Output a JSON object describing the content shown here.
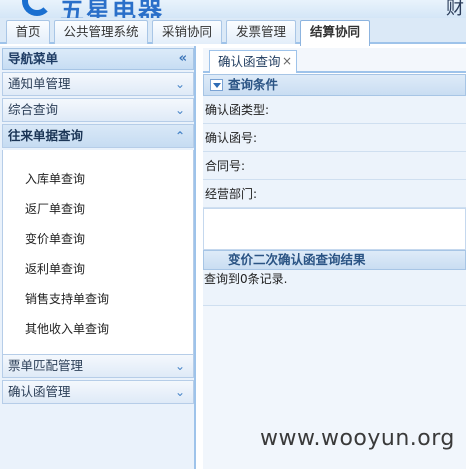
{
  "brand": {
    "logo_text": "五星电器",
    "right_text": "财"
  },
  "topnav": {
    "tabs": [
      "首页",
      "公共管理系统",
      "采销协同",
      "发票管理",
      "结算协同"
    ],
    "active_index": 4
  },
  "sidebar": {
    "title": "导航菜单",
    "collapse_glyph": "«",
    "sections": [
      {
        "label": "通知单管理",
        "glyph": "⌄"
      },
      {
        "label": "综合查询",
        "glyph": "⌄"
      },
      {
        "label": "往来单据查询",
        "glyph": "⌃"
      },
      {
        "label": "票单匹配管理",
        "glyph": "⌄"
      },
      {
        "label": "确认函管理",
        "glyph": "⌄"
      }
    ],
    "open_section_index": 2,
    "sub_items": [
      "入库单查询",
      "返厂单查询",
      "变价单查询",
      "返利单查询",
      "销售支持单查询",
      "其他收入单查询"
    ]
  },
  "main": {
    "tab": {
      "label": "确认函查询",
      "close": "×"
    },
    "query_panel": {
      "title": "查询条件",
      "fields": [
        "确认函类型:",
        "确认函号:",
        "合同号:",
        "经营部门:"
      ]
    },
    "results": {
      "title": "变价二次确认函查询结果",
      "message": "查询到0条记录."
    }
  },
  "watermark": "www.wooyun.org",
  "colors": {
    "accent": "#9ec3ea",
    "panel_bg": "#ecf3fb",
    "title_text": "#2b5484"
  }
}
